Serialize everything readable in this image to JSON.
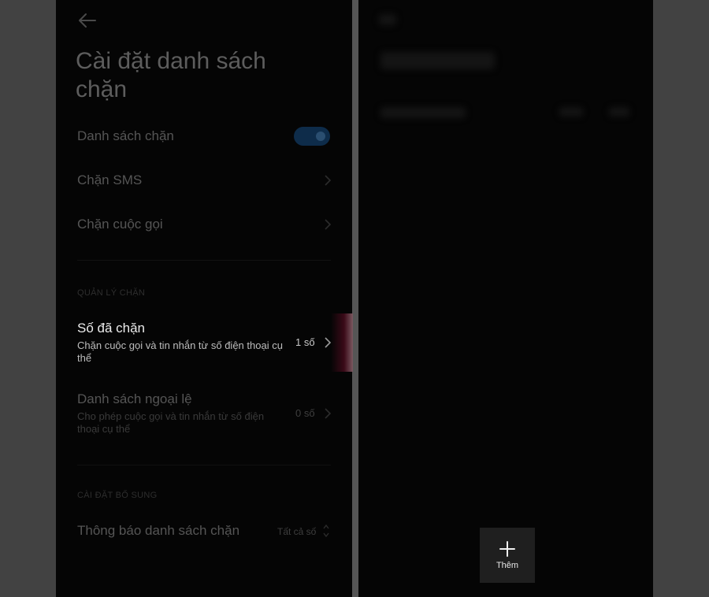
{
  "left": {
    "title": "Cài đặt danh sách chặn",
    "items": {
      "blocklist": {
        "label": "Danh sách chặn",
        "enabled": true
      },
      "block_sms": {
        "label": "Chặn SMS"
      },
      "block_calls": {
        "label": "Chặn cuộc gọi"
      }
    },
    "section_manage": "QUẢN LÝ CHẶN",
    "blocked_numbers": {
      "label": "Số đã chặn",
      "description": "Chặn cuộc gọi và tin nhắn từ số điện thoại cụ thể",
      "count": "1 số"
    },
    "exceptions": {
      "label": "Danh sách ngoại lệ",
      "description": "Cho phép cuộc gọi và tin nhắn từ số điện thoại cụ thể",
      "count": "0 số"
    },
    "section_extra": "CÀI ĐẶT BỔ SUNG",
    "notifications": {
      "label": "Thông báo danh sách chặn",
      "value": "Tất cả số"
    }
  },
  "right": {
    "add_label": "Thêm"
  },
  "colors": {
    "background": "#424242",
    "panel": "#050505",
    "toggle_track": "#0e2c4a",
    "highlight_text": "#ececec"
  },
  "icons": [
    "back-arrow-icon",
    "chevron-right-icon",
    "up-down-chevron-icon",
    "plus-icon"
  ]
}
